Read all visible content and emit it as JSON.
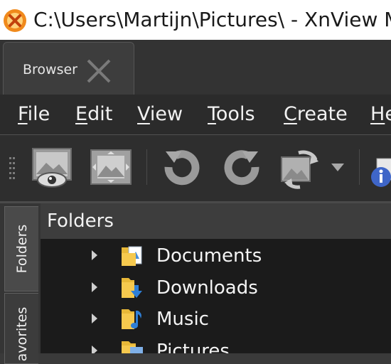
{
  "window": {
    "title": "C:\\Users\\Martijn\\Pictures\\ - XnView M"
  },
  "tabs": [
    {
      "label": "Browser"
    }
  ],
  "menu": [
    {
      "mnemonic": "F",
      "rest": "ile"
    },
    {
      "mnemonic": "E",
      "rest": "dit"
    },
    {
      "mnemonic": "V",
      "rest": "iew"
    },
    {
      "mnemonic": "T",
      "rest": "ools"
    },
    {
      "mnemonic": "C",
      "rest": "reate"
    },
    {
      "mnemonic": "H",
      "rest": "e"
    }
  ],
  "toolbar": {
    "buttons": [
      "view-image-icon",
      "fullscreen-icon",
      "rotate-left-icon",
      "rotate-right-icon",
      "convert-icon",
      "info-icon"
    ]
  },
  "sidebar": {
    "tabs": [
      {
        "label": "Folders"
      },
      {
        "label": "avorites"
      }
    ]
  },
  "panel": {
    "title": "Folders"
  },
  "tree": {
    "items": [
      {
        "label": "Documents",
        "icon": "documents-folder-icon"
      },
      {
        "label": "Downloads",
        "icon": "downloads-folder-icon"
      },
      {
        "label": "Music",
        "icon": "music-folder-icon"
      },
      {
        "label": "Pictures",
        "icon": "pictures-folder-icon"
      }
    ]
  },
  "colors": {
    "folder": "#e8b838",
    "accent_blue": "#2f7fd6"
  }
}
